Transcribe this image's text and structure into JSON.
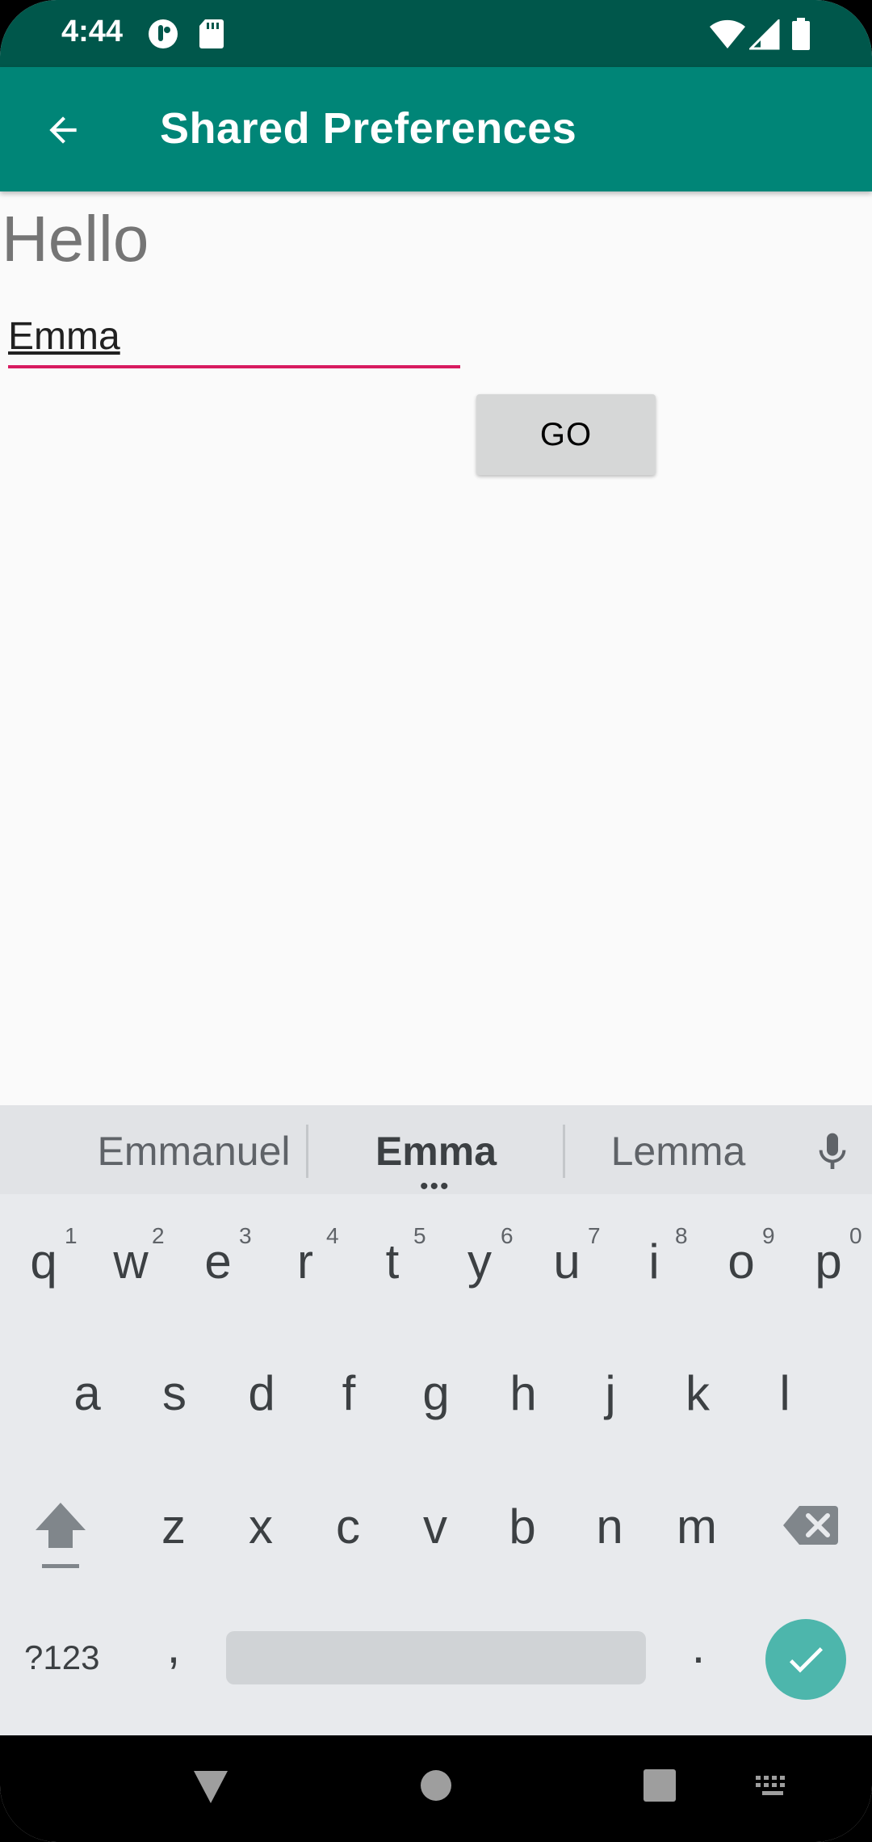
{
  "status_bar": {
    "time": "4:44",
    "left_icons": [
      "notification-icon",
      "sd-card-icon"
    ],
    "right_icons": [
      "wifi-icon",
      "signal-icon",
      "battery-icon"
    ]
  },
  "app_bar": {
    "title": "Shared Preferences",
    "back_icon": "arrow-back-icon",
    "color": "#008577"
  },
  "content": {
    "greeting": "Hello",
    "name_input_value": "Emma",
    "go_label": "GO",
    "accent": "#d81b60"
  },
  "keyboard": {
    "suggestions": [
      "Emmanuel",
      "Emma",
      "Lemma"
    ],
    "row1": [
      "q",
      "w",
      "e",
      "r",
      "t",
      "y",
      "u",
      "i",
      "o",
      "p"
    ],
    "row1_hints": [
      "1",
      "2",
      "3",
      "4",
      "5",
      "6",
      "7",
      "8",
      "9",
      "0"
    ],
    "row2": [
      "a",
      "s",
      "d",
      "f",
      "g",
      "h",
      "j",
      "k",
      "l"
    ],
    "row3": [
      "z",
      "x",
      "c",
      "v",
      "b",
      "n",
      "m"
    ],
    "symbols_label": "?123",
    "comma": ",",
    "period": ".",
    "enter_color": "#4db6ac"
  },
  "nav_bar": {
    "icons": [
      "back-icon",
      "home-icon",
      "recents-icon",
      "keyboard-icon"
    ]
  }
}
